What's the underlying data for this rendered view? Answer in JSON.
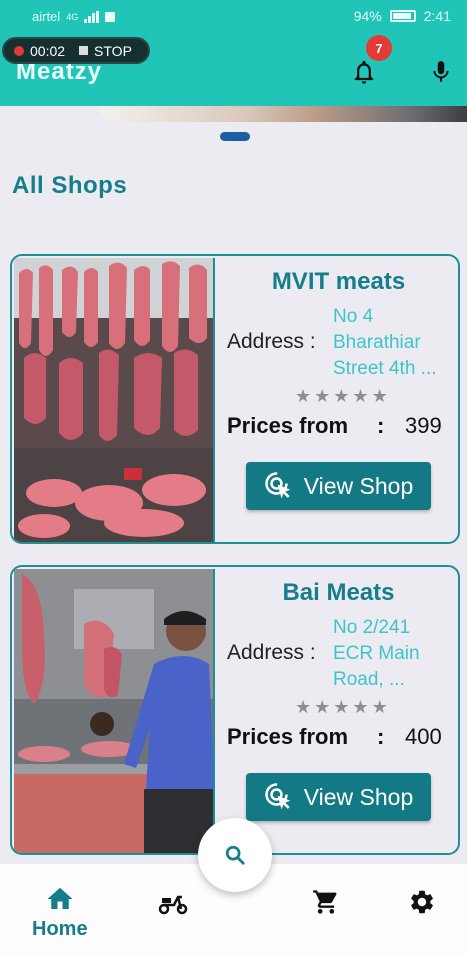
{
  "status_bar": {
    "carrier": "airtel",
    "network": "4G",
    "battery": "94%",
    "time": "2:41"
  },
  "recording": {
    "elapsed": "00:02",
    "stop_label": "STOP"
  },
  "header": {
    "app_title": "Meatzy",
    "notification_count": "7",
    "icons": [
      "bell-icon",
      "mic-icon"
    ]
  },
  "section_title": "All Shops",
  "shops": [
    {
      "name": "MVIT meats",
      "address_label": "Address :",
      "address": "No 4\nBharathiar\nStreet 4th ...",
      "rating_stars": 0,
      "rating_max": 5,
      "price_label": "Prices from",
      "price_sep": ":",
      "price": "399",
      "button_label": "View Shop"
    },
    {
      "name": "Bai Meats",
      "address_label": "Address :",
      "address": "No 2/241\nECR Main\nRoad, ...",
      "rating_stars": 0,
      "rating_max": 5,
      "price_label": "Prices from",
      "price_sep": ":",
      "price": "400",
      "button_label": "View Shop"
    }
  ],
  "bottom_nav": {
    "items": [
      {
        "name": "home",
        "label": "Home",
        "icon": "home-icon",
        "active": true
      },
      {
        "name": "delivery",
        "label": "",
        "icon": "scooter-icon",
        "active": false
      },
      {
        "name": "cart",
        "label": "",
        "icon": "cart-icon",
        "active": false
      },
      {
        "name": "settings",
        "label": "",
        "icon": "gear-icon",
        "active": false
      }
    ]
  },
  "colors": {
    "primary": "#20c5b8",
    "accent_dark": "#137a85",
    "title_teal": "#157e8a",
    "address_text": "#3fc3cc",
    "badge": "#e53935"
  }
}
